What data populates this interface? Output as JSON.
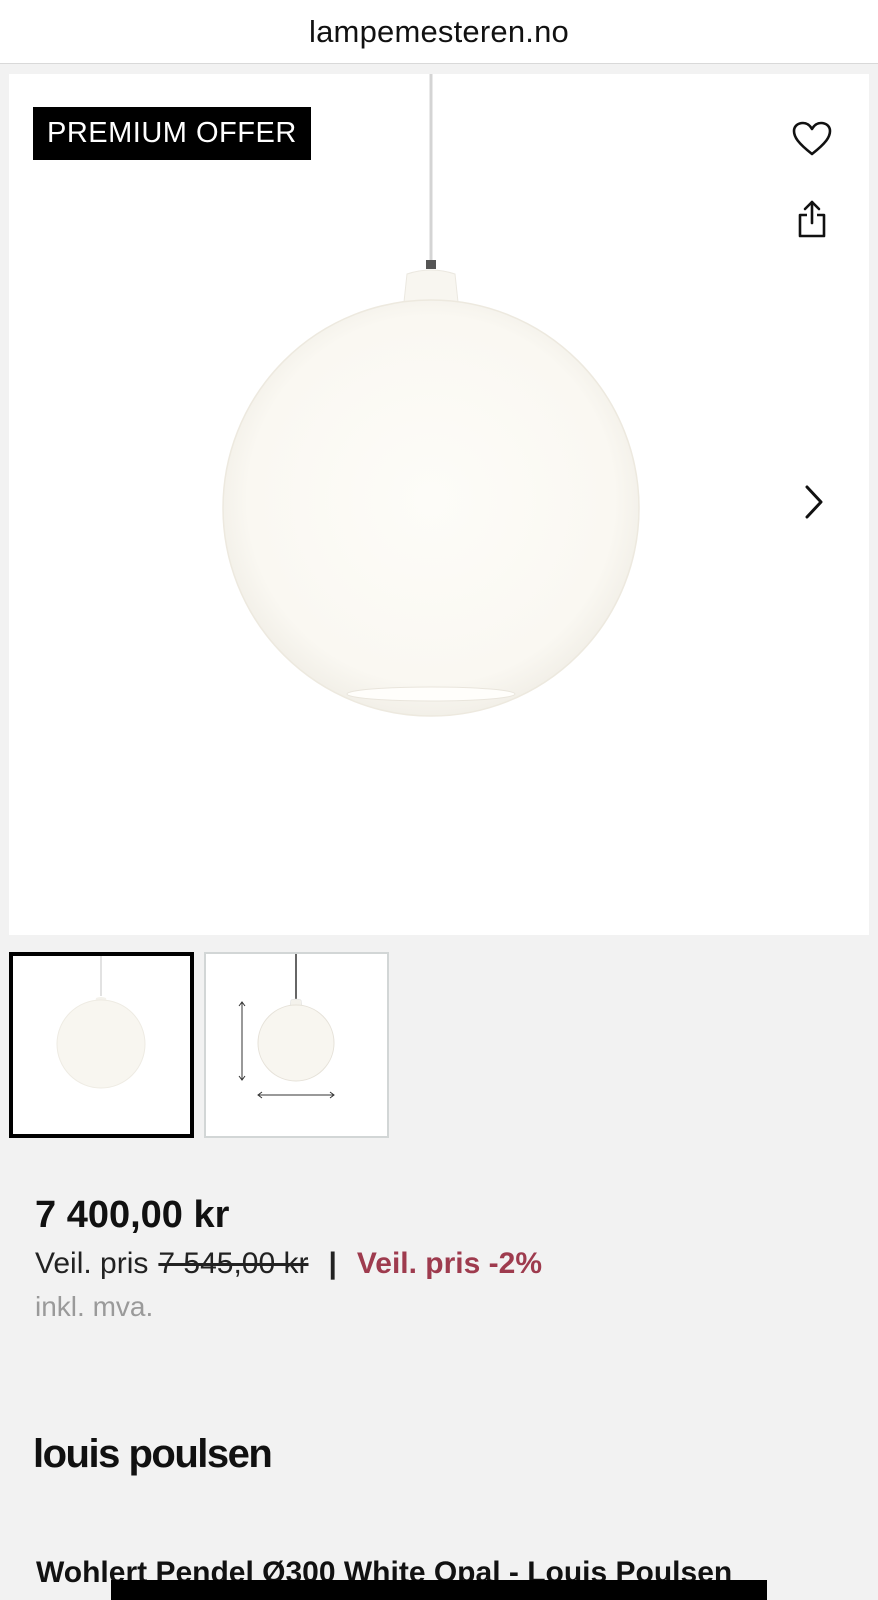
{
  "browser": {
    "url": "lampemesteren.no"
  },
  "gallery": {
    "badge": "PREMIUM OFFER",
    "icons": {
      "favorite": "heart-icon",
      "share": "share-icon",
      "next": "chevron-right-icon"
    },
    "thumbnail_count": 2,
    "active_thumbnail": 1
  },
  "pricing": {
    "price": "7 400,00 kr",
    "recommended_label": "Veil. pris",
    "recommended_price": "7 545,00 kr",
    "separator": "|",
    "discount_label": "Veil. pris -2%",
    "vat_note": "inkl. mva."
  },
  "brand": {
    "name": "louis poulsen"
  },
  "product": {
    "title": "Wohlert Pendel Ø300 White Opal - Louis Poulsen"
  },
  "colors": {
    "discount": "#9e3b4e",
    "badge_bg": "#000000",
    "page_bg": "#f2f2f2"
  }
}
